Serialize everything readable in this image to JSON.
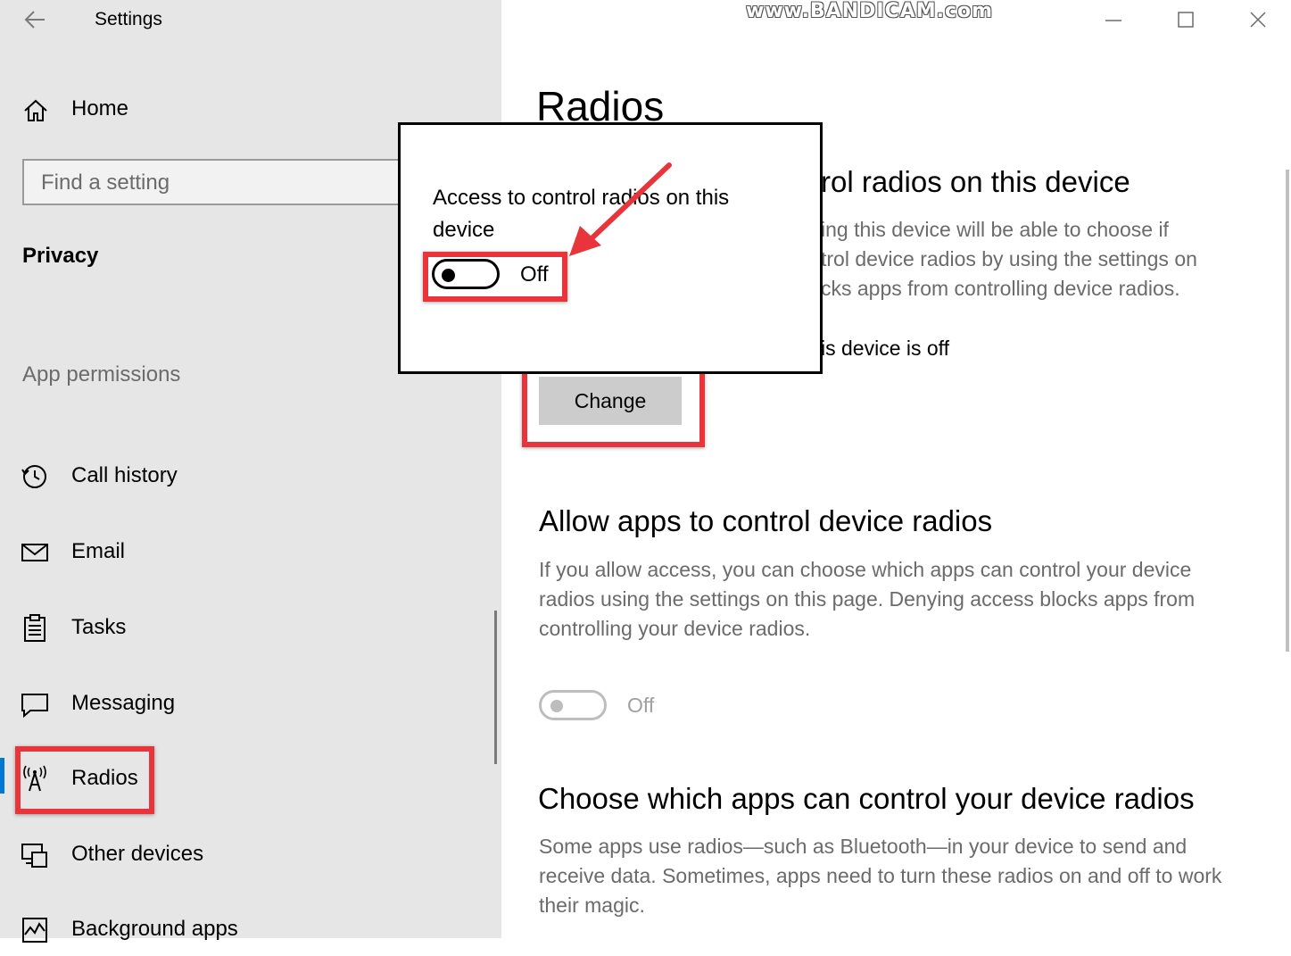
{
  "window": {
    "app_title": "Settings",
    "watermark": "www.BANDICAM.com"
  },
  "sidebar": {
    "home_label": "Home",
    "search_placeholder": "Find a setting",
    "section_title": "Privacy",
    "group_title": "App permissions",
    "items": [
      {
        "label": "Call history",
        "icon": "call-history-icon"
      },
      {
        "label": "Email",
        "icon": "email-icon"
      },
      {
        "label": "Tasks",
        "icon": "tasks-icon"
      },
      {
        "label": "Messaging",
        "icon": "messaging-icon"
      },
      {
        "label": "Radios",
        "icon": "radios-icon",
        "selected": true
      },
      {
        "label": "Other devices",
        "icon": "other-devices-icon"
      },
      {
        "label": "Background apps",
        "icon": "background-apps-icon"
      }
    ]
  },
  "main": {
    "title": "Radios",
    "device_access": {
      "heading_visible": "rol radios on this device",
      "desc_lines": [
        "ing this device will be able to choose if",
        "trol device radios by using the settings on",
        "cks apps from controlling device radios."
      ],
      "status_visible": "is device is off",
      "change_label": "Change"
    },
    "allow_apps": {
      "heading": "Allow apps to control device radios",
      "desc": "If you allow access, you can choose which apps can control your device radios using the settings on this page. Denying access blocks apps from controlling your device radios.",
      "toggle_label": "Off",
      "toggle_on": false
    },
    "choose_apps": {
      "heading": "Choose which apps can control your device radios",
      "desc": "Some apps use radios—such as Bluetooth—in your device to send and receive data. Sometimes, apps need to turn these radios on and off to work their magic."
    }
  },
  "dialog": {
    "text": "Access to control radios on this device",
    "toggle_label": "Off",
    "toggle_on": false
  },
  "colors": {
    "highlight": "#e8353b",
    "accent": "#0078d4",
    "sidebar_bg": "#e6e6e6"
  }
}
